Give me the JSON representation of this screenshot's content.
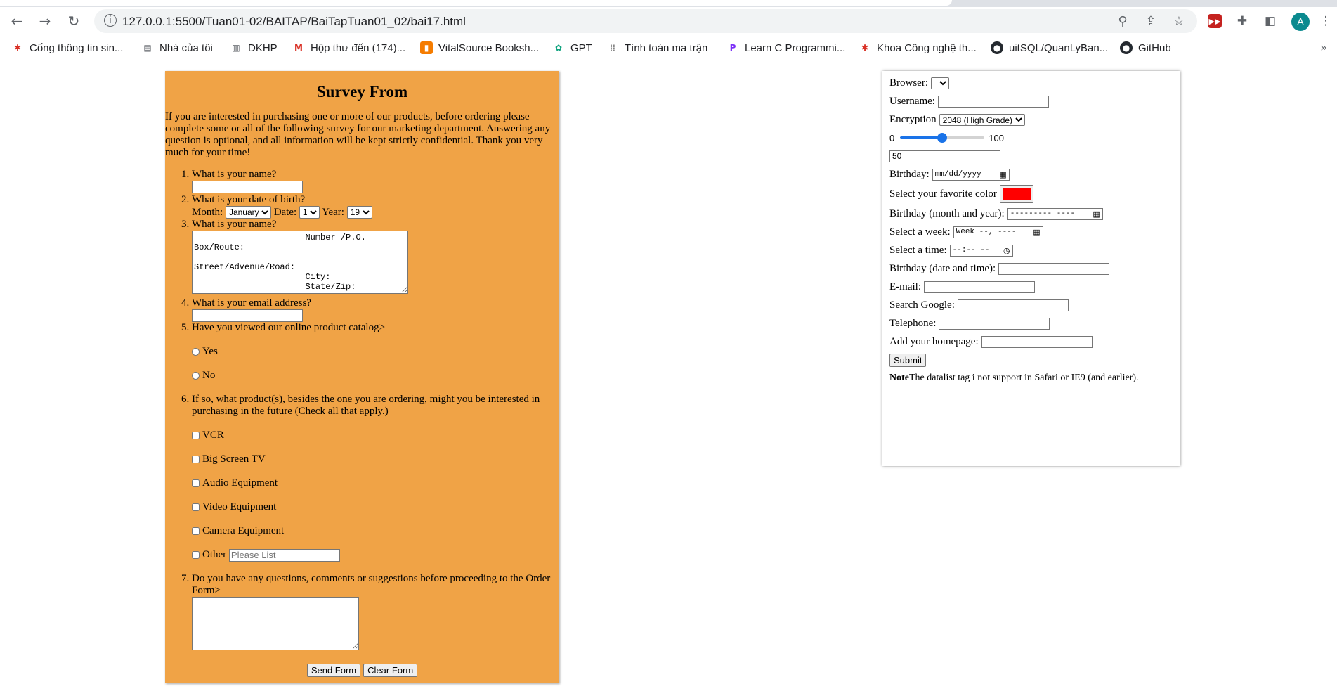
{
  "browser": {
    "url": "127.0.0.1:5500/Tuan01-02/BAITAP/BaiTapTuan01_02/bai17.html",
    "avatar_letter": "A",
    "bookmarks": [
      {
        "label": "Cổng thông tin sin..."
      },
      {
        "label": "Nhà của tôi"
      },
      {
        "label": "DKHP"
      },
      {
        "label": "Hộp thư đến (174)..."
      },
      {
        "label": "VitalSource Booksh..."
      },
      {
        "label": "GPT"
      },
      {
        "label": "Tính toán ma trận"
      },
      {
        "label": "Learn C Programmi..."
      },
      {
        "label": "Khoa Công nghệ th..."
      },
      {
        "label": "uitSQL/QuanLyBan..."
      },
      {
        "label": "GitHub"
      }
    ]
  },
  "survey": {
    "title": "Survey From",
    "intro": "If you are interested in purchasing one or more of our products, before ordering please complete some or all of the following survey for our marketing department. Answering any question is optional, and all information will be kept strictly confidential. Thank you very much for your time!",
    "q1": "What is your name?",
    "q2": "What is your date of birth?",
    "month_label": "Month:",
    "month_value": "January",
    "date_label": "Date:",
    "date_value": "1",
    "year_label": "Year:",
    "year_value": "19",
    "q3": "What is your name?",
    "address_text": "                      Number /P.O. Box/Route:\n\nStreet/Advenue/Road:\n                      City:\n                      State/Zip:",
    "q4": "What is your email address?",
    "q5": "Have you viewed our online product catalog>",
    "yes": "Yes",
    "no": "No",
    "q6": "If so, what product(s), besides the one you are ordering, might you be interested in purchasing in the future (Check all that apply.)",
    "products": [
      "VCR",
      "Big Screen TV",
      "Audio Equipment",
      "Video Equipment",
      "Camera Equipment"
    ],
    "other_label": "Other",
    "other_placeholder": "Please List",
    "q7": "Do you have any questions, comments or suggestions before proceeding to the Order Form>",
    "send_label": "Send Form",
    "clear_label": "Clear Form"
  },
  "form2": {
    "browser_label": "Browser:",
    "username_label": "Username:",
    "encryption_label": "Encryption",
    "encryption_value": "2048 (High Grade)",
    "range_min": "0",
    "range_max": "100",
    "range_fraction": 0.5,
    "range_output": "50",
    "birthday_label": "Birthday:",
    "birthday_placeholder": "mm/dd/yyyy",
    "color_label": "Select your favorite color",
    "favorite_color": "#ff0000",
    "month_year_label": "Birthday (month and year):",
    "month_placeholder": "--------- ----",
    "week_label": "Select a week:",
    "week_placeholder": "Week --, ----",
    "time_label": "Select a time:",
    "time_placeholder": "--:-- --",
    "datetime_label": "Birthday (date and time):",
    "email_label": "E-mail:",
    "search_label": "Search Google:",
    "telephone_label": "Telephone:",
    "homepage_label": "Add your homepage:",
    "submit_label": "Submit",
    "note_bold": "Note",
    "note_text": "The datalist tag i not support in Safari or IE9 (and earlier)."
  }
}
